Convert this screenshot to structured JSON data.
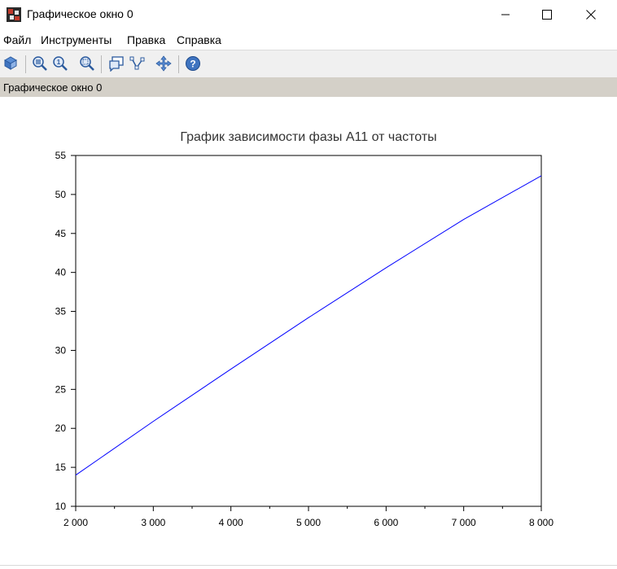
{
  "window": {
    "title": "Графическое окно 0",
    "controls": {
      "minimize": "minimize-icon",
      "maximize": "maximize-icon",
      "close": "close-icon"
    }
  },
  "menu": {
    "items": [
      {
        "label": "Файл"
      },
      {
        "label": "Инструменты"
      },
      {
        "label": "Правка"
      },
      {
        "label": "Справка"
      }
    ]
  },
  "toolbar": {
    "buttons": [
      {
        "icon": "rotate-icon"
      },
      {
        "icon": "zoom-in-icon"
      },
      {
        "icon": "zoom-original-icon"
      },
      {
        "icon": "zoom-area-icon"
      },
      {
        "icon": "datatip-icon"
      },
      {
        "icon": "curve-editor-icon"
      },
      {
        "icon": "pan-icon"
      },
      {
        "icon": "help-icon"
      }
    ]
  },
  "infobar": {
    "text": "Графическое окно 0"
  },
  "chart_data": {
    "type": "line",
    "title": "График зависимости фазы A11 от частоты",
    "xlabel": "",
    "ylabel": "",
    "xlim": [
      2000,
      8000
    ],
    "ylim": [
      10,
      55
    ],
    "x_ticks": [
      "2 000",
      "3 000",
      "4 000",
      "5 000",
      "6 000",
      "7 000",
      "8 000"
    ],
    "x_tick_values": [
      2000,
      3000,
      4000,
      5000,
      6000,
      7000,
      8000
    ],
    "y_ticks": [
      "10",
      "15",
      "20",
      "25",
      "30",
      "35",
      "40",
      "45",
      "50",
      "55"
    ],
    "y_tick_values": [
      10,
      15,
      20,
      25,
      30,
      35,
      40,
      45,
      50,
      55
    ],
    "grid": false,
    "series": [
      {
        "color": "#0000ff",
        "x": [
          2000,
          3000,
          4000,
          5000,
          6000,
          7000,
          8000
        ],
        "y": [
          14.0,
          20.9,
          27.6,
          34.2,
          40.6,
          46.8,
          52.4
        ]
      }
    ]
  }
}
